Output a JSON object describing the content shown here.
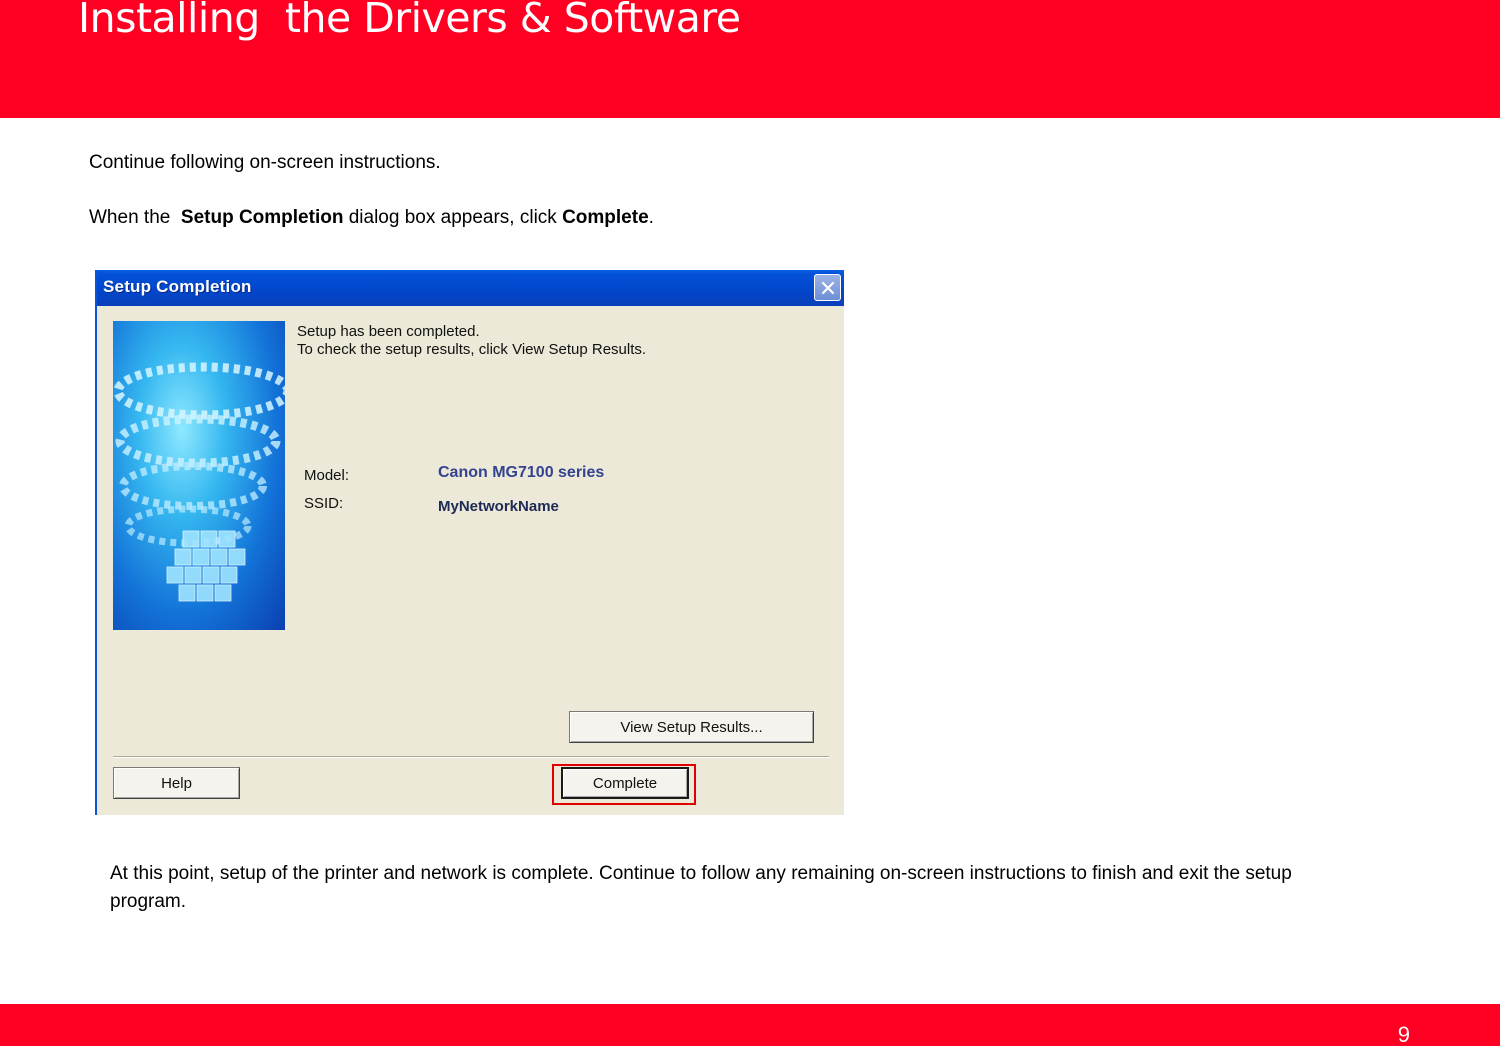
{
  "header": {
    "title": "Installing  the Drivers & Software"
  },
  "instructions": {
    "line1": "Continue following on-screen instructions.",
    "line2_prefix": "When the  ",
    "line2_bold1": "Setup Completion",
    "line2_mid": " dialog box appears, click ",
    "line2_bold2": "Complete",
    "line2_suffix": "."
  },
  "dialog": {
    "title": "Setup Completion",
    "message_line1": "Setup has been completed.",
    "message_line2": "To check the setup results, click View Setup Results.",
    "model_label": "Model:",
    "model_value": "Canon MG7100 series",
    "ssid_label": "SSID:",
    "ssid_value": "MyNetworkName",
    "view_results_label": "View Setup Results...",
    "help_label": "Help",
    "complete_label": "Complete",
    "close_icon": "close-icon",
    "title_color": "#0147cc",
    "model_color": "#33438f"
  },
  "footer_text": "At this point, setup of the printer and network is complete.  Continue to follow any remaining on-screen instructions to finish and exit the setup program.",
  "page_number": "9",
  "colors": {
    "brand_red": "#ff0022",
    "highlight_red": "#e00000"
  }
}
